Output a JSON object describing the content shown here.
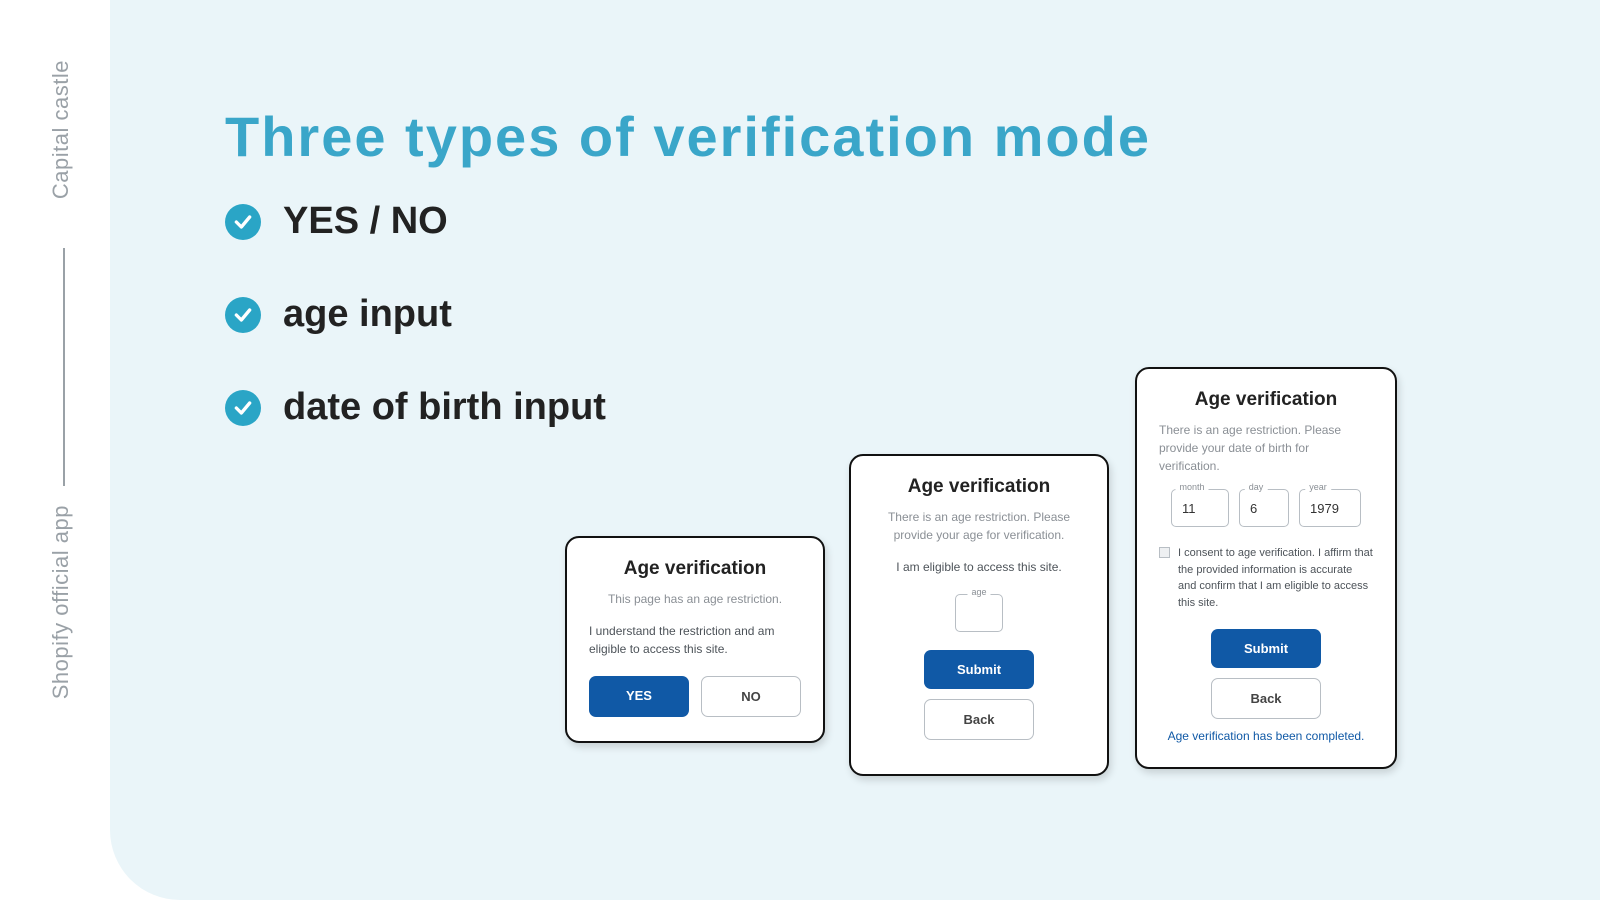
{
  "sidebar": {
    "top": "Capital castle",
    "bottom": "Shopify official app"
  },
  "heading": "Three types of verification mode",
  "bullets": [
    "YES / NO",
    "age input",
    "date of birth input"
  ],
  "card1": {
    "title": "Age verification",
    "sub": "This page has an age restriction.",
    "desc": "I understand the restriction and am eligible to access this site.",
    "yes": "YES",
    "no": "NO"
  },
  "card2": {
    "title": "Age verification",
    "sub": "There is an age restriction. Please provide your age for verification.",
    "eligible": "I am eligible to access this site.",
    "age_legend": "age",
    "submit": "Submit",
    "back": "Back"
  },
  "card3": {
    "title": "Age verification",
    "sub": "There is an age restriction. Please provide your date of birth for verification.",
    "month_legend": "month",
    "day_legend": "day",
    "year_legend": "year",
    "month": "11",
    "day": "6",
    "year": "1979",
    "consent": "I consent to age verification. I affirm that the provided information is accurate and confirm that I am eligible to access this site.",
    "submit": "Submit",
    "back": "Back",
    "completed": "Age verification has been completed."
  }
}
